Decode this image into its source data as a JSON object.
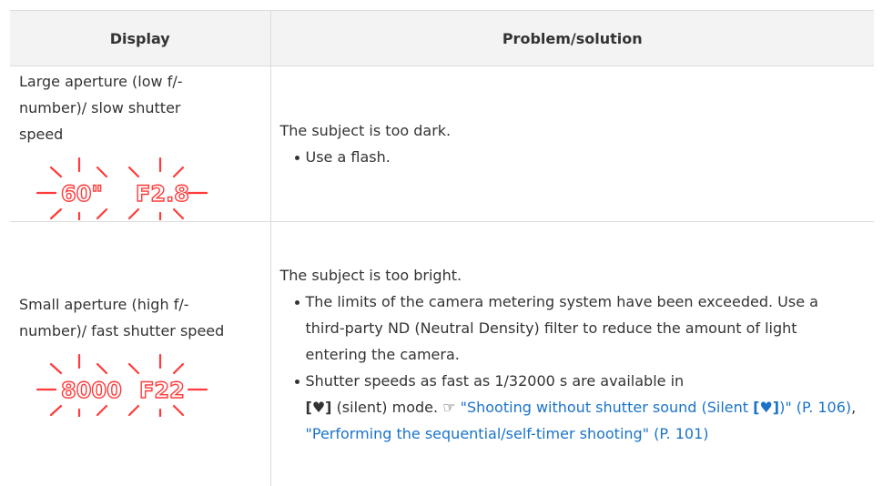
{
  "table": {
    "headers": {
      "display": "Display",
      "solution": "Problem/solution"
    },
    "rows": [
      {
        "display_text": "Large aperture (low f/-number)/ slow shutter speed",
        "lcd": {
          "shutter": "60\"",
          "aperture": "F2.8"
        },
        "problem": "The subject is too dark.",
        "bullets": [
          "Use a flash."
        ]
      },
      {
        "display_text": "Small aperture (high f/-number)/ fast shutter speed",
        "lcd": {
          "shutter": "8000",
          "aperture": "F22"
        },
        "problem": "The subject is too bright.",
        "bullets": [
          "The limits of the camera metering system have been exceeded. Use a third-party ND (Neutral Density) filter to reduce the amount of light entering the camera."
        ],
        "shutter_bullet": {
          "lead": "Shutter speeds as fast as 1/32000 s are available in",
          "mode_open": "[",
          "heart": "♥",
          "mode_close": "]",
          "mode_text": "(silent) mode.",
          "ref_icon": "☞",
          "link1_a": "\"Shooting without shutter sound (Silent ",
          "link1_heart_open": "[",
          "link1_heart": "♥",
          "link1_heart_close": "]",
          "link1_b": ")\" (P. 106)",
          "separator": ", ",
          "link2": "\"Performing the sequential/self-timer shooting\" (P. 101)"
        }
      }
    ]
  },
  "colors": {
    "blink": "#ff3b3b",
    "link": "#1a73c9",
    "header_bg": "#f3f3f3"
  }
}
